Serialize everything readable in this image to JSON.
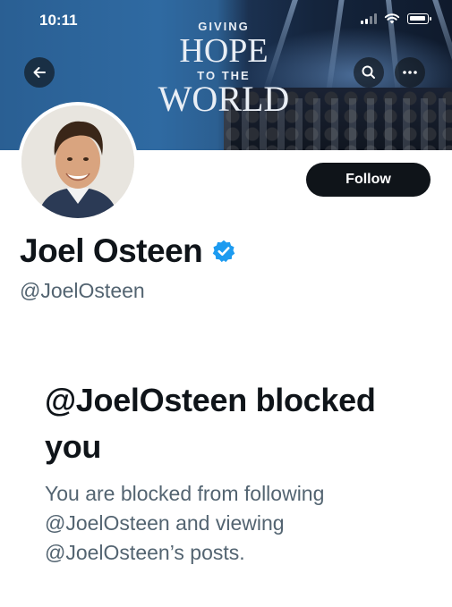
{
  "status_bar": {
    "time": "10:11"
  },
  "banner": {
    "line1": "GIVING",
    "line2": "HOPE",
    "line3": "TO THE",
    "line4": "WORLD"
  },
  "header": {
    "back_icon": "arrow-left-icon",
    "search_icon": "search-icon",
    "more_icon": "more-horizontal-icon"
  },
  "profile": {
    "display_name": "Joel Osteen",
    "handle": "@JoelOsteen",
    "verified": true,
    "verified_color": "#1d9bf0",
    "follow_label": "Follow"
  },
  "blocked": {
    "title": "@JoelOsteen blocked you",
    "description": "You are blocked from following @JoelOsteen and viewing @JoelOsteen’s posts."
  }
}
